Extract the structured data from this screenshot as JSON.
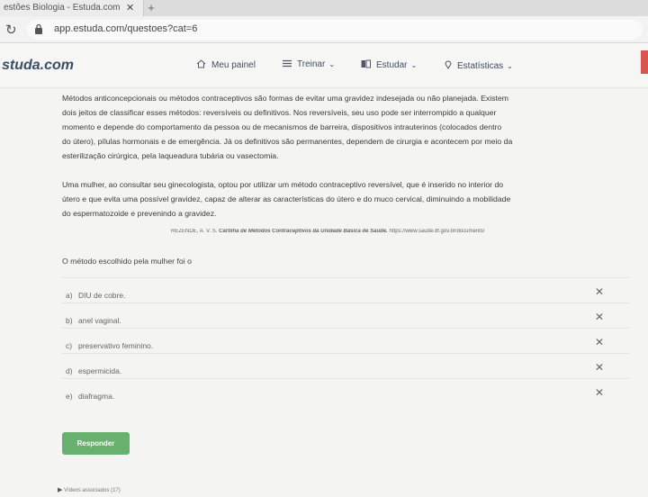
{
  "browser": {
    "tab_title": "estões Biologia - Estuda.com",
    "tab_close": "✕",
    "new_tab": "+",
    "url": "app.estuda.com/questoes?cat=6"
  },
  "header": {
    "logo": "studa.com",
    "nav": [
      {
        "label": "Meu painel",
        "icon": "home-icon"
      },
      {
        "label": "Treinar",
        "icon": "list-icon",
        "has_dropdown": true
      },
      {
        "label": "Estudar",
        "icon": "book-icon",
        "has_dropdown": true
      },
      {
        "label": "Estatísticas",
        "icon": "pin-icon",
        "has_dropdown": true
      }
    ]
  },
  "question": {
    "intro_lines": [
      "Métodos anticoncepcionais ou métodos contraceptivos são formas de evitar uma gravidez indesejada ou não planejada. Existem",
      "dois jeitos de classificar esses métodos: reversíveis ou definitivos. Nos reversíveis, seu uso pode ser interrompido a qualquer",
      "momento e depende do comportamento da pessoa ou de mecanismos de barreira, dispositivos intrauterinos (colocados dentro",
      "do útero), pílulas hormonais e de emergência. Já os definitivos são permanentes, dependem de cirurgia e acontecem por meio da",
      "esterilização cirúrgica, pela laqueadura tubária ou vasectomia."
    ],
    "scenario_lines": [
      "Uma mulher, ao consultar seu ginecologista, optou por utilizar um método contraceptivo reversível, que é inserido no interior do",
      "útero e que evita uma possível gravidez, capaz de alterar as características do útero e do muco cervical, diminuindo a mobilidade",
      "do espermatozoide e prevenindo a gravidez."
    ],
    "citation_prefix": "REZENDE, A. V. S.",
    "citation_title": "Cartilha de Métodos Contraceptivos da Unidade Básica de Saúde.",
    "citation_url": "https://www.saude.df.gov.br/documents/",
    "prompt": "O método escolhido pela mulher foi o",
    "options": [
      {
        "letter": "a)",
        "text": "DIU de cobre."
      },
      {
        "letter": "b)",
        "text": "anel vaginal."
      },
      {
        "letter": "c)",
        "text": "preservativo feminino."
      },
      {
        "letter": "d)",
        "text": "espermicida."
      },
      {
        "letter": "e)",
        "text": "diafragma."
      }
    ],
    "eliminate_mark": "✕",
    "submit_label": "Responder",
    "videos_label": "Vídeos associados (17)"
  }
}
